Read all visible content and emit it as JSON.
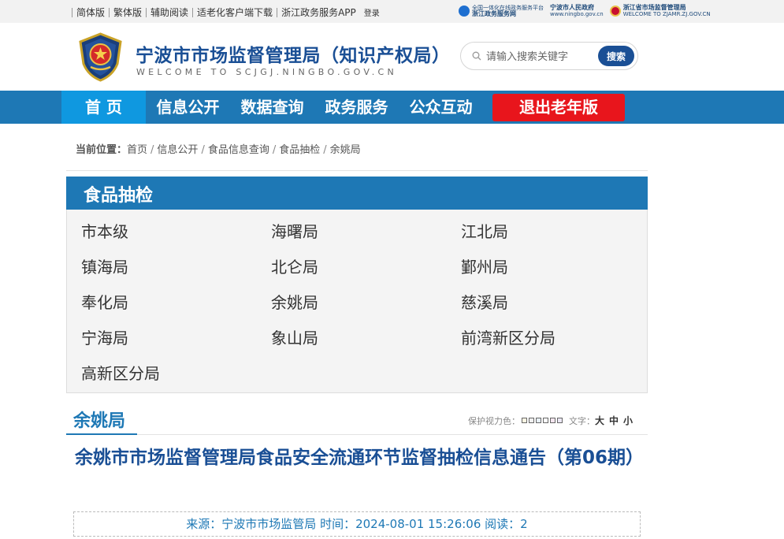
{
  "topbar": {
    "links": [
      "简体版",
      "繁体版",
      "辅助阅读",
      "适老化客户端下载",
      "浙江政务服务APP"
    ],
    "login": "登录",
    "badges": [
      {
        "small": "全国一体化在线政务服务平台",
        "main": "浙江政务服务网",
        "icon": "zhejiang-service-icon"
      },
      {
        "small": "宁波市人民政府",
        "main": "www.ningbo.gov.cn",
        "icon": ""
      },
      {
        "small": "浙江省市场监督管理局",
        "main": "WELCOME TO ZJAMR.ZJ.GOV.CN",
        "icon": "provincial-emblem-icon"
      }
    ]
  },
  "header": {
    "title": "宁波市市场监督管理局（知识产权局）",
    "subtitle": "WELCOME TO SCJGJ.NINGBO.GOV.CN",
    "search_placeholder": "请输入搜索关键字",
    "search_button": "搜索"
  },
  "nav": {
    "home": "首 页",
    "items": [
      "信息公开",
      "数据查询",
      "政务服务",
      "公众互动"
    ],
    "exit": "退出老年版"
  },
  "breadcrumb": {
    "label": "当前位置：",
    "items": [
      "首页",
      "信息公开",
      "食品信息查询",
      "食品抽检",
      "余姚局"
    ],
    "separator": "/"
  },
  "panel": {
    "title": "食品抽检",
    "categories": [
      "市本级",
      "海曙局",
      "江北局",
      "镇海局",
      "北仑局",
      "鄞州局",
      "奉化局",
      "余姚局",
      "慈溪局",
      "宁海局",
      "象山局",
      "前湾新区分局",
      "高新区分局"
    ]
  },
  "section": {
    "title": "余姚局",
    "color_label": "保护视力色：",
    "swatches": [
      "#fdf6e3",
      "#f0f0f0",
      "#e8f0f8",
      "#ffffff",
      "#f5e6f0",
      "#ece8f5"
    ],
    "font_label": "文字：",
    "font_sizes": [
      "大",
      "中",
      "小"
    ]
  },
  "article": {
    "title": "余姚市市场监督管理局食品安全流通环节监督抽检信息通告（第06期）",
    "meta": "来源：宁波市市场监管局 时间：2024-08-01 15:26:06 阅读：2"
  }
}
